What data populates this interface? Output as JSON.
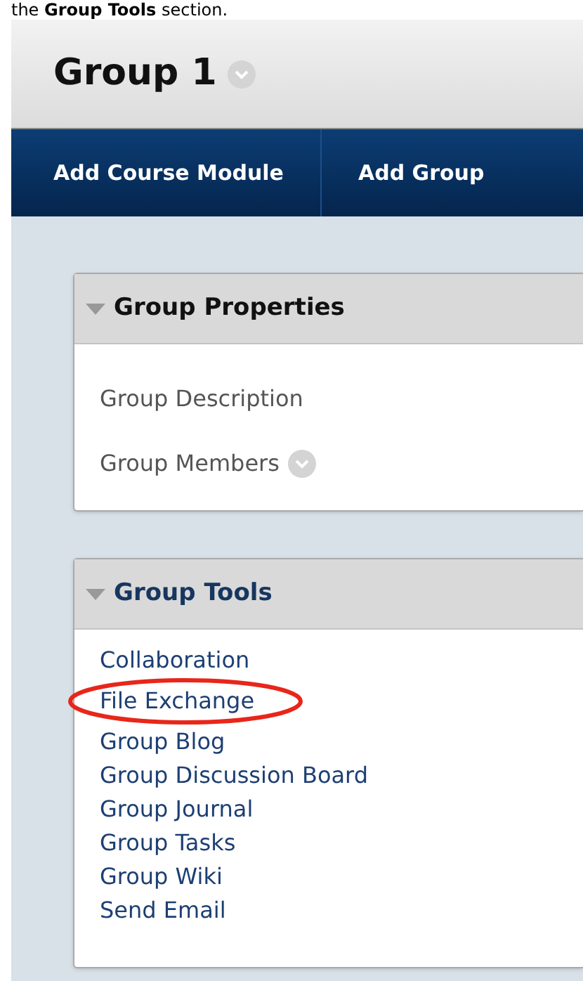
{
  "caption": "the **Group Tools** section.",
  "page_title": "Group 1",
  "nav": [
    {
      "label": "Add Course Module"
    },
    {
      "label": "Add Group"
    }
  ],
  "panels": [
    {
      "title": "Group Properties",
      "expanded": true,
      "kind": "spaced",
      "items": [
        {
          "label": "Group Description",
          "menu": false
        },
        {
          "label": "Group Members",
          "menu": true
        }
      ]
    },
    {
      "title": "Group Tools",
      "expanded": true,
      "kind": "compact",
      "items": [
        {
          "label": "Collaboration",
          "highlighted": false
        },
        {
          "label": "File Exchange",
          "highlighted": true
        },
        {
          "label": "Group Blog",
          "highlighted": false
        },
        {
          "label": "Group Discussion Board",
          "highlighted": false
        },
        {
          "label": "Group Journal",
          "highlighted": false
        },
        {
          "label": "Group Tasks",
          "highlighted": false
        },
        {
          "label": "Group Wiki",
          "highlighted": false
        },
        {
          "label": "Send Email",
          "highlighted": false
        }
      ]
    }
  ]
}
